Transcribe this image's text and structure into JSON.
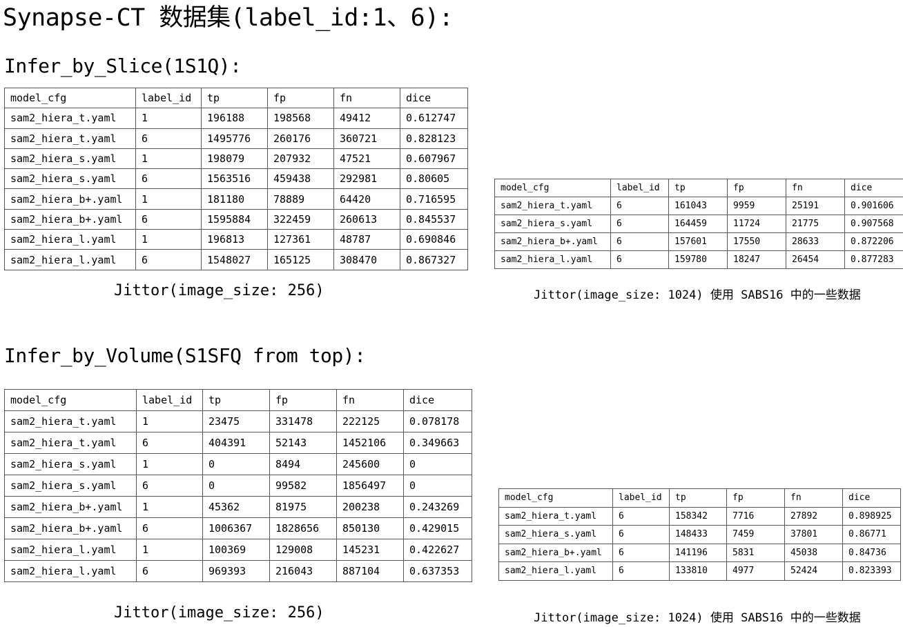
{
  "title": "Synapse-CT 数据集(label_id:1、6):",
  "sections": [
    {
      "heading": "Infer_by_Slice(1S1Q):",
      "left": {
        "caption": "Jittor(image_size: 256)",
        "headers": [
          "model_cfg",
          "label_id",
          "tp",
          "fp",
          "fn",
          "dice"
        ],
        "rows": [
          [
            "sam2_hiera_t.yaml",
            "1",
            "196188",
            "198568",
            "49412",
            "0.612747"
          ],
          [
            "sam2_hiera_t.yaml",
            "6",
            "1495776",
            "260176",
            "360721",
            "0.828123"
          ],
          [
            "sam2_hiera_s.yaml",
            "1",
            "198079",
            "207932",
            "47521",
            "0.607967"
          ],
          [
            "sam2_hiera_s.yaml",
            "6",
            "1563516",
            "459438",
            "292981",
            "0.80605"
          ],
          [
            "sam2_hiera_b+.yaml",
            "1",
            "181180",
            "78889",
            "64420",
            "0.716595"
          ],
          [
            "sam2_hiera_b+.yaml",
            "6",
            "1595884",
            "322459",
            "260613",
            "0.845537"
          ],
          [
            "sam2_hiera_l.yaml",
            "1",
            "196813",
            "127361",
            "48787",
            "0.690846"
          ],
          [
            "sam2_hiera_l.yaml",
            "6",
            "1548027",
            "165125",
            "308470",
            "0.867327"
          ]
        ]
      },
      "right": {
        "caption": "Jittor(image_size: 1024) 使用 SABS16 中的一些数据",
        "headers": [
          "model_cfg",
          "label_id",
          "tp",
          "fp",
          "fn",
          "dice"
        ],
        "rows": [
          [
            "sam2_hiera_t.yaml",
            "6",
            "161043",
            "9959",
            "25191",
            "0.901606"
          ],
          [
            "sam2_hiera_s.yaml",
            "6",
            "164459",
            "11724",
            "21775",
            "0.907568"
          ],
          [
            "sam2_hiera_b+.yaml",
            "6",
            "157601",
            "17550",
            "28633",
            "0.872206"
          ],
          [
            "sam2_hiera_l.yaml",
            "6",
            "159780",
            "18247",
            "26454",
            "0.877283"
          ]
        ]
      }
    },
    {
      "heading": "Infer_by_Volume(S1SFQ from top):",
      "left": {
        "caption": "Jittor(image_size: 256)",
        "headers": [
          "model_cfg",
          "label_id",
          "tp",
          "fp",
          "fn",
          "dice"
        ],
        "rows": [
          [
            "sam2_hiera_t.yaml",
            "1",
            "23475",
            "331478",
            "222125",
            "0.078178"
          ],
          [
            "sam2_hiera_t.yaml",
            "6",
            "404391",
            "52143",
            "1452106",
            "0.349663"
          ],
          [
            "sam2_hiera_s.yaml",
            "1",
            "0",
            "8494",
            "245600",
            "0"
          ],
          [
            "sam2_hiera_s.yaml",
            "6",
            "0",
            "99582",
            "1856497",
            "0"
          ],
          [
            "sam2_hiera_b+.yaml",
            "1",
            "45362",
            "81975",
            "200238",
            "0.243269"
          ],
          [
            "sam2_hiera_b+.yaml",
            "6",
            "1006367",
            "1828656",
            "850130",
            "0.429015"
          ],
          [
            "sam2_hiera_l.yaml",
            "1",
            "100369",
            "129008",
            "145231",
            "0.422627"
          ],
          [
            "sam2_hiera_l.yaml",
            "6",
            "969393",
            "216043",
            "887104",
            "0.637353"
          ]
        ]
      },
      "right": {
        "caption": "Jittor(image_size: 1024) 使用 SABS16 中的一些数据",
        "headers": [
          "model_cfg",
          "label_id",
          "tp",
          "fp",
          "fn",
          "dice"
        ],
        "rows": [
          [
            "sam2_hiera_t.yaml",
            "6",
            "158342",
            "7716",
            "27892",
            "0.898925"
          ],
          [
            "sam2_hiera_s.yaml",
            "6",
            "148433",
            "7459",
            "37801",
            "0.86771"
          ],
          [
            "sam2_hiera_b+.yaml",
            "6",
            "141196",
            "5831",
            "45038",
            "0.84736"
          ],
          [
            "sam2_hiera_l.yaml",
            "6",
            "133810",
            "4977",
            "52424",
            "0.823393"
          ]
        ]
      }
    }
  ]
}
